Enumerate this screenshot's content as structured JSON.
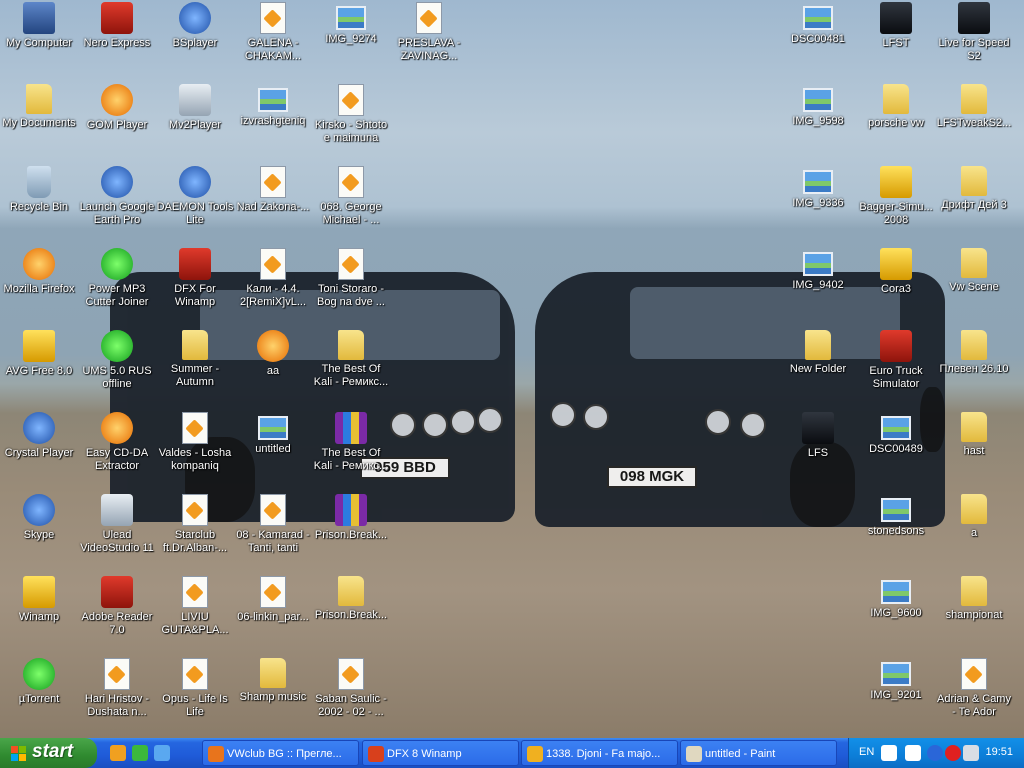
{
  "desktop": {
    "icons": [
      {
        "label": "My Computer",
        "icon": "my-computer-icon",
        "style": "ig-pc"
      },
      {
        "label": "My Documents",
        "icon": "my-documents-icon",
        "style": "ig-folder"
      },
      {
        "label": "Recycle Bin",
        "icon": "recycle-bin-icon",
        "style": "ig-bin"
      },
      {
        "label": "Mozilla Firefox",
        "icon": "firefox-icon",
        "style": "ig-orange"
      },
      {
        "label": "AVG Free 8.0",
        "icon": "avg-icon",
        "style": "ig-yellowbox"
      },
      {
        "label": "Crystal Player",
        "icon": "crystal-player-icon",
        "style": "ig-blue"
      },
      {
        "label": "Skype",
        "icon": "skype-icon",
        "style": "ig-blue"
      },
      {
        "label": "Winamp",
        "icon": "winamp-icon",
        "style": "ig-yellowbox"
      },
      {
        "label": "µTorrent",
        "icon": "utorrent-icon",
        "style": "ig-green"
      },
      {
        "label": "Nero Express",
        "icon": "nero-express-icon",
        "style": "ig-red"
      },
      {
        "label": "GOM Player",
        "icon": "gom-player-icon",
        "style": "ig-orange"
      },
      {
        "label": "Launch Google Earth Pro",
        "icon": "google-earth-icon",
        "style": "ig-blue"
      },
      {
        "label": "Power MP3 Cutter Joiner",
        "icon": "mp3-cutter-icon",
        "style": "ig-green"
      },
      {
        "label": "UMS 5.0 RUS offline",
        "icon": "ums-icon",
        "style": "ig-green"
      },
      {
        "label": "Easy CD-DA Extractor",
        "icon": "cd-extractor-icon",
        "style": "ig-orange"
      },
      {
        "label": "Ulead VideoStudio 11",
        "icon": "videostudio-icon",
        "style": "ig-grey"
      },
      {
        "label": "Adobe Reader 7.0",
        "icon": "adobe-reader-icon",
        "style": "ig-red"
      },
      {
        "label": "Hari Hristov - Dushata n...",
        "icon": "audio-file-icon",
        "style": "ig-doc"
      },
      {
        "label": "BSplayer",
        "icon": "bsplayer-icon",
        "style": "ig-blue"
      },
      {
        "label": "Mv2Player",
        "icon": "mv2player-icon",
        "style": "ig-grey"
      },
      {
        "label": "DAEMON Tools Lite",
        "icon": "daemon-tools-icon",
        "style": "ig-blue"
      },
      {
        "label": "DFX For Winamp",
        "icon": "dfx-icon",
        "style": "ig-red"
      },
      {
        "label": "Summer - Autumn",
        "icon": "folder-icon",
        "style": "ig-folder"
      },
      {
        "label": "Valdes - Losha kompaniq",
        "icon": "audio-file-icon",
        "style": "ig-doc"
      },
      {
        "label": "Starclub ft.Dr.Alban-...",
        "icon": "audio-file-icon",
        "style": "ig-doc"
      },
      {
        "label": "LIVIU GUTA&PLA...",
        "icon": "audio-file-icon",
        "style": "ig-doc"
      },
      {
        "label": "Opus - Life Is Life",
        "icon": "audio-file-icon",
        "style": "ig-doc"
      },
      {
        "label": "GALENA - CHAKAM...",
        "icon": "audio-file-icon",
        "style": "ig-doc"
      },
      {
        "label": "izvrashgteniq",
        "icon": "image-file-icon",
        "style": "ig-img"
      },
      {
        "label": "Nad Zakona-...",
        "icon": "audio-file-icon",
        "style": "ig-doc"
      },
      {
        "label": "Кали - 4.4. 2[RemiX]vL...",
        "icon": "audio-file-icon",
        "style": "ig-doc"
      },
      {
        "label": "aa",
        "icon": "paint-file-icon",
        "style": "ig-orange"
      },
      {
        "label": "untitled",
        "icon": "image-file-icon",
        "style": "ig-img"
      },
      {
        "label": "08 - Kamarad - Tanti, tanti",
        "icon": "audio-file-icon",
        "style": "ig-doc"
      },
      {
        "label": "06-linkin_par...",
        "icon": "audio-file-icon",
        "style": "ig-doc"
      },
      {
        "label": "Shamp music",
        "icon": "folder-icon",
        "style": "ig-folder"
      },
      {
        "label": "IMG_9274",
        "icon": "image-file-icon",
        "style": "ig-img"
      },
      {
        "label": "Kirsko - Shtoto e maimuna",
        "icon": "audio-file-icon",
        "style": "ig-doc"
      },
      {
        "label": "068. George Michael - ...",
        "icon": "audio-file-icon",
        "style": "ig-doc"
      },
      {
        "label": "Toni Storaro - Bog na dve ...",
        "icon": "audio-file-icon",
        "style": "ig-doc"
      },
      {
        "label": "The Best Of Kali - Ремикс...",
        "icon": "folder-icon",
        "style": "ig-folder"
      },
      {
        "label": "The Best Of Kali - Ремикс...",
        "icon": "winrar-icon",
        "style": "ig-rar"
      },
      {
        "label": "Prison.Break...",
        "icon": "winrar-icon",
        "style": "ig-rar"
      },
      {
        "label": "Prison.Break...",
        "icon": "folder-icon",
        "style": "ig-folder"
      },
      {
        "label": "Saban Saulic - 2002 - 02 - ...",
        "icon": "audio-file-icon",
        "style": "ig-doc"
      },
      {
        "label": "PRESLAVA - ZAVINAG...",
        "icon": "audio-file-icon",
        "style": "ig-doc"
      },
      {
        "label": "DSC00481",
        "icon": "image-file-icon",
        "style": "ig-img"
      },
      {
        "label": "IMG_9598",
        "icon": "image-file-icon",
        "style": "ig-img"
      },
      {
        "label": "IMG_9336",
        "icon": "image-file-icon",
        "style": "ig-img"
      },
      {
        "label": "IMG_9402",
        "icon": "image-file-icon",
        "style": "ig-img"
      },
      {
        "label": "New Folder",
        "icon": "folder-icon",
        "style": "ig-folder"
      },
      {
        "label": "LFS",
        "icon": "lfs-icon",
        "style": "ig-dark"
      },
      {
        "label": "LFST",
        "icon": "lfst-icon",
        "style": "ig-dark"
      },
      {
        "label": "porsche vw",
        "icon": "folder-icon",
        "style": "ig-folder"
      },
      {
        "label": "Bagger-Simu... 2008",
        "icon": "bagger-simulator-icon",
        "style": "ig-yellowbox"
      },
      {
        "label": "Cora3",
        "icon": "cora3-icon",
        "style": "ig-yellowbox"
      },
      {
        "label": "Euro Truck Simulator",
        "icon": "euro-truck-icon",
        "style": "ig-red"
      },
      {
        "label": "DSC00489",
        "icon": "image-file-icon",
        "style": "ig-img"
      },
      {
        "label": "stonedsons",
        "icon": "image-file-icon",
        "style": "ig-img"
      },
      {
        "label": "IMG_9600",
        "icon": "image-file-icon",
        "style": "ig-img"
      },
      {
        "label": "IMG_9201",
        "icon": "image-file-icon",
        "style": "ig-img"
      },
      {
        "label": "Live for Speed S2",
        "icon": "live-for-speed-icon",
        "style": "ig-dark"
      },
      {
        "label": "LFSTweakS2...",
        "icon": "folder-icon",
        "style": "ig-folder"
      },
      {
        "label": "Дрифт Дей 3",
        "icon": "folder-icon",
        "style": "ig-folder"
      },
      {
        "label": "Vw Scene",
        "icon": "folder-icon",
        "style": "ig-folder"
      },
      {
        "label": "Плевен 26.10",
        "icon": "folder-icon",
        "style": "ig-folder"
      },
      {
        "label": "hast",
        "icon": "folder-icon",
        "style": "ig-folder"
      },
      {
        "label": "a",
        "icon": "folder-icon",
        "style": "ig-folder"
      },
      {
        "label": "shampionat",
        "icon": "folder-icon",
        "style": "ig-folder"
      },
      {
        "label": "Adrian & Camy - Te Ador",
        "icon": "audio-file-icon",
        "style": "ig-doc"
      }
    ],
    "wallpaper": {
      "left_plate": "059 BBD",
      "right_plate": "098 MGK"
    }
  },
  "taskbar": {
    "start_label": "start",
    "quick_launch": [
      {
        "icon": "gom-player-icon",
        "color": "#f0a020"
      },
      {
        "icon": "utorrent-icon",
        "color": "#3cb83c"
      },
      {
        "icon": "internet-explorer-icon",
        "color": "#5aa8f0"
      }
    ],
    "tasks": [
      {
        "label": "VWclub BG :: Прегле...",
        "icon": "firefox-icon",
        "color": "#e8741c"
      },
      {
        "label": "DFX 8 Winamp",
        "icon": "dfx-icon",
        "color": "#d8401c"
      },
      {
        "label": "1338. Djoni - Fa majo...",
        "icon": "winamp-icon",
        "color": "#f0b020"
      },
      {
        "label": "untitled - Paint",
        "icon": "paint-icon",
        "color": "#e0d8c0"
      }
    ],
    "tray": {
      "language": "EN",
      "time": "19:51",
      "icons": [
        {
          "icon": "help-icon",
          "color": "#ffffff"
        },
        {
          "icon": "network-icon",
          "color": "#ffffff"
        },
        {
          "icon": "back-arrow-icon",
          "color": "#2a66d8"
        },
        {
          "icon": "no-entry-icon",
          "color": "#e02020"
        },
        {
          "icon": "display-icon",
          "color": "#d8dde4"
        }
      ]
    }
  }
}
